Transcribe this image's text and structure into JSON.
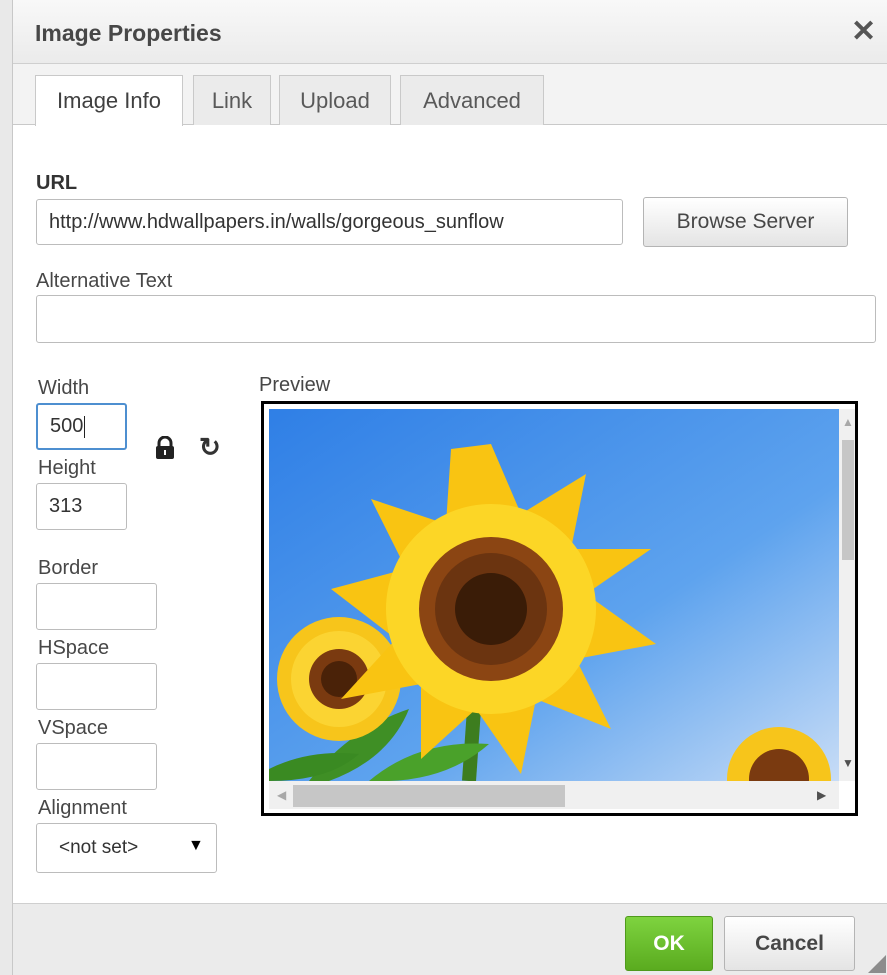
{
  "dialog": {
    "title": "Image Properties",
    "close_icon": "close-icon"
  },
  "tabs": [
    {
      "label": "Image Info",
      "active": true
    },
    {
      "label": "Link",
      "active": false
    },
    {
      "label": "Upload",
      "active": false
    },
    {
      "label": "Advanced",
      "active": false
    }
  ],
  "url": {
    "label": "URL",
    "value": "http://www.hdwallpapers.in/walls/gorgeous_sunflow",
    "browse_label": "Browse Server"
  },
  "alt_text": {
    "label": "Alternative Text",
    "value": ""
  },
  "dimensions": {
    "width_label": "Width",
    "width_value": "500",
    "height_label": "Height",
    "height_value": "313",
    "lock_icon": "lock-icon",
    "reset_icon": "reset-size-icon"
  },
  "border": {
    "label": "Border",
    "value": ""
  },
  "hspace": {
    "label": "HSpace",
    "value": ""
  },
  "vspace": {
    "label": "VSpace",
    "value": ""
  },
  "alignment": {
    "label": "Alignment",
    "value": "<not set>"
  },
  "preview": {
    "label": "Preview"
  },
  "footer": {
    "ok_label": "OK",
    "cancel_label": "Cancel"
  },
  "colors": {
    "ok_green": "#6cc02d",
    "focus_blue": "#4e8fd0",
    "sky": "#3b86e8"
  }
}
